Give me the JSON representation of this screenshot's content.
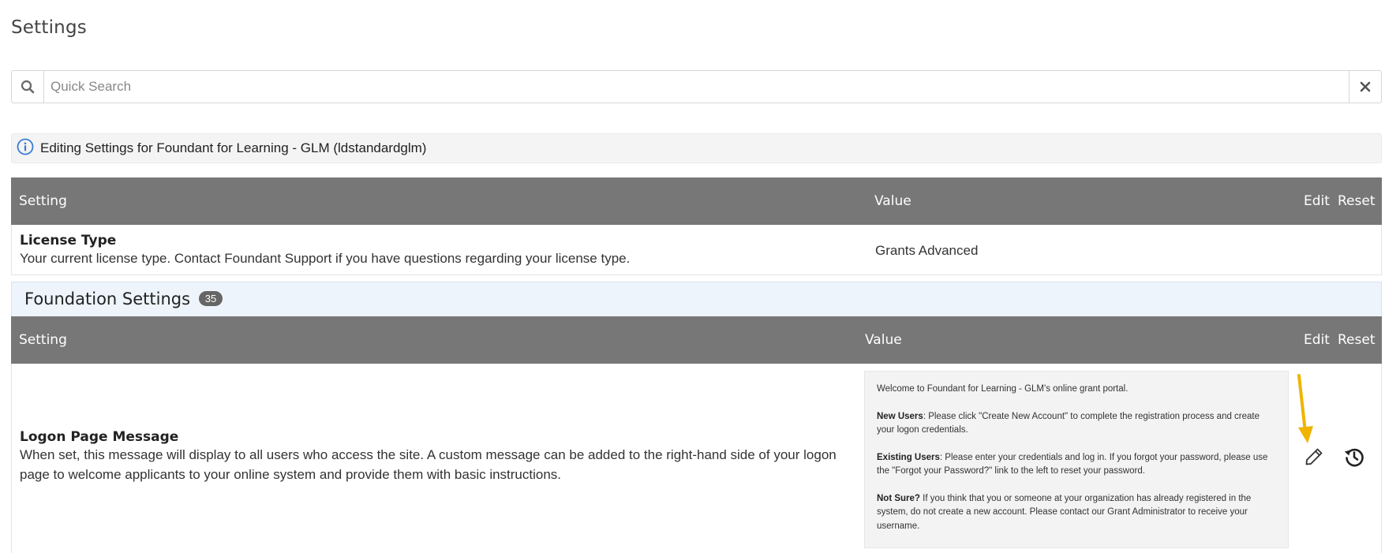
{
  "page": {
    "title": "Settings"
  },
  "search": {
    "placeholder": "Quick Search",
    "value": ""
  },
  "info": {
    "text": "Editing Settings for Foundant for Learning - GLM (ldstandardglm)"
  },
  "license_table": {
    "headers": {
      "setting": "Setting",
      "value": "Value",
      "edit": "Edit",
      "reset": "Reset"
    },
    "row": {
      "name": "License Type",
      "description": "Your current license type. Contact Foundant Support if you have questions regarding your license type.",
      "value": "Grants Advanced"
    }
  },
  "foundation_section": {
    "title": "Foundation Settings",
    "count": "35",
    "headers": {
      "setting": "Setting",
      "value": "Value",
      "edit": "Edit",
      "reset": "Reset"
    },
    "rows": [
      {
        "name": "Logon Page Message",
        "description": "When set, this message will display to all users who access the site. A custom message can be added to the right-hand side of your logon page to welcome applicants to your online system and provide them with basic instructions.",
        "value": {
          "intro": "Welcome to Foundant for Learning - GLM's online grant portal.",
          "new_users_label": "New Users",
          "new_users_text": ": Please click \"Create New Account\" to complete the registration process and create your logon credentials.",
          "existing_users_label": "Existing Users",
          "existing_users_text": ": Please enter your credentials and log in. If you forgot your password, please use the \"Forgot your Password?\" link to the left to reset your password.",
          "not_sure_label": "Not Sure?",
          "not_sure_text": " If you think that you or someone at your organization has already registered in the system, do not create a new account. Please contact our Grant Administrator to receive your username."
        }
      }
    ]
  },
  "icons": {
    "search": "search-icon",
    "clear": "close-icon",
    "info": "info-icon",
    "edit": "pencil-icon",
    "reset": "history-icon",
    "annotation": "arrow-down-icon"
  },
  "colors": {
    "header_bg": "#777777",
    "accent": "#3a7bd5",
    "arrow": "#f0b400"
  }
}
